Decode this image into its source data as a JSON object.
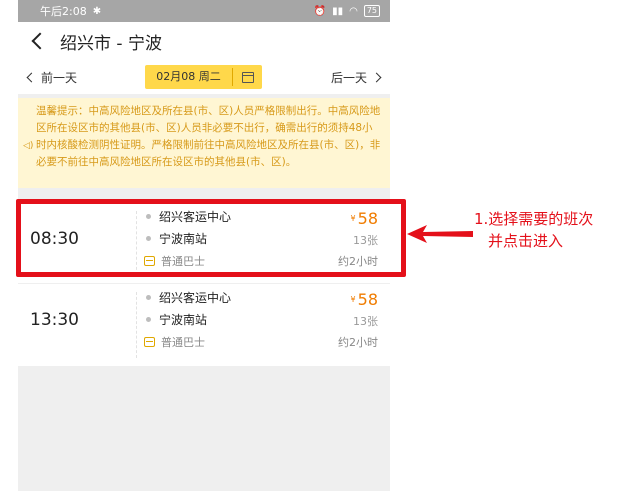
{
  "status_bar": {
    "time": "午后2:08",
    "bluetooth_glyph": "✱",
    "battery": "75"
  },
  "header": {
    "title": "绍兴市 - 宁波"
  },
  "date_bar": {
    "prev": "前一天",
    "date": "02月08 周二",
    "next": "后一天"
  },
  "notice": {
    "text": "温馨提示：中高风险地区及所在县(市、区)人员严格限制出行。中高风险地区所在设区市的其他县(市、区)人员非必要不出行，确需出行的须持48小时内核酸检测阴性证明。严格限制前往中高风险地区及所在县(市、区)，非必要不前往中高风险地区所在设区市的其他县(市、区)。"
  },
  "trips": [
    {
      "time": "08:30",
      "from": "绍兴客运中心",
      "to": "宁波南站",
      "bus_type": "普通巴士",
      "currency": "¥",
      "price": "58",
      "seats": "13张",
      "duration": "约2小时"
    },
    {
      "time": "13:30",
      "from": "绍兴客运中心",
      "to": "宁波南站",
      "bus_type": "普通巴士",
      "currency": "¥",
      "price": "58",
      "seats": "13张",
      "duration": "约2小时"
    }
  ],
  "annotation": {
    "line1": "1.选择需要的班次",
    "line2": "并点击进入",
    "color": "#e4101a"
  },
  "colors": {
    "accent": "#ffd84a",
    "price": "#f07c00",
    "notice_bg": "#fff6d3"
  }
}
